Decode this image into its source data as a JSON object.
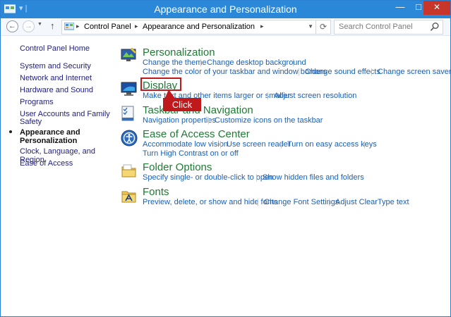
{
  "window": {
    "title": "Appearance and Personalization",
    "controls": {
      "minimize": "—",
      "maximize": "□",
      "close": "✕"
    }
  },
  "navbar": {
    "back": "←",
    "forward": "→",
    "up": "↑",
    "breadcrumbs": [
      "Control Panel",
      "Appearance and Personalization"
    ],
    "search_placeholder": "Search Control Panel"
  },
  "sidebar": {
    "items": [
      {
        "label": "Control Panel Home"
      },
      {
        "label": "System and Security"
      },
      {
        "label": "Network and Internet"
      },
      {
        "label": "Hardware and Sound"
      },
      {
        "label": "Programs"
      },
      {
        "label": "User Accounts and Family"
      },
      {
        "label": "Safety"
      },
      {
        "label": "Appearance and"
      },
      {
        "label": "Personalization"
      },
      {
        "label": "Clock, Language, and Region"
      },
      {
        "label": "Ease of Access"
      }
    ]
  },
  "categories": [
    {
      "title": "Personalization",
      "links": [
        "Change the theme",
        "Change desktop background",
        "Change the color of your taskbar and window borders",
        "Change sound effects",
        "Change screen saver"
      ]
    },
    {
      "title": "Display",
      "links": [
        "Make text and other items larger or smaller",
        "Adjust screen resolution"
      ]
    },
    {
      "title": "Taskbar and Navigation",
      "links": [
        "Navigation properties",
        "Customize icons on the taskbar"
      ]
    },
    {
      "title": "Ease of Access Center",
      "links": [
        "Accommodate low vision",
        "Use screen reader",
        "Turn on easy access keys",
        "Turn High Contrast on or off"
      ]
    },
    {
      "title": "Folder Options",
      "links": [
        "Specify single- or double-click to open",
        "Show hidden files and folders"
      ]
    },
    {
      "title": "Fonts",
      "links": [
        "Preview, delete, or show and hide fonts",
        "Change Font Settings",
        "Adjust ClearType text"
      ]
    }
  ],
  "annotation": {
    "callout_label": "Click"
  },
  "colors": {
    "titlebar": "#2b88d8",
    "category_title": "#1e7b33",
    "link": "#1a5fb4",
    "highlight": "#c0191c"
  }
}
